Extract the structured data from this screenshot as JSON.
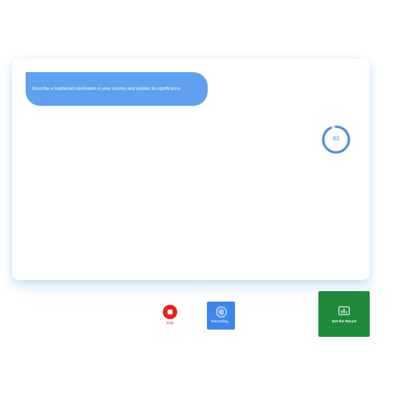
{
  "question": {
    "text": "Describe a traditional celebration in your country and explain its significance."
  },
  "timer": {
    "value": "83",
    "progress_fraction": 0.93
  },
  "controls": {
    "stop_label": "Stop",
    "recording_label": "Recording...",
    "result_label": "Get the Result"
  },
  "icons": {
    "stop": "stop-icon",
    "recording": "microphone-waveform-icon",
    "result": "bar-chart-icon"
  },
  "colors": {
    "bubble": "#5fa1f0",
    "timer_ring": "#4a8fd8",
    "stop": "#e8211c",
    "recording": "#3e86ea",
    "result": "#1e8a3a"
  }
}
